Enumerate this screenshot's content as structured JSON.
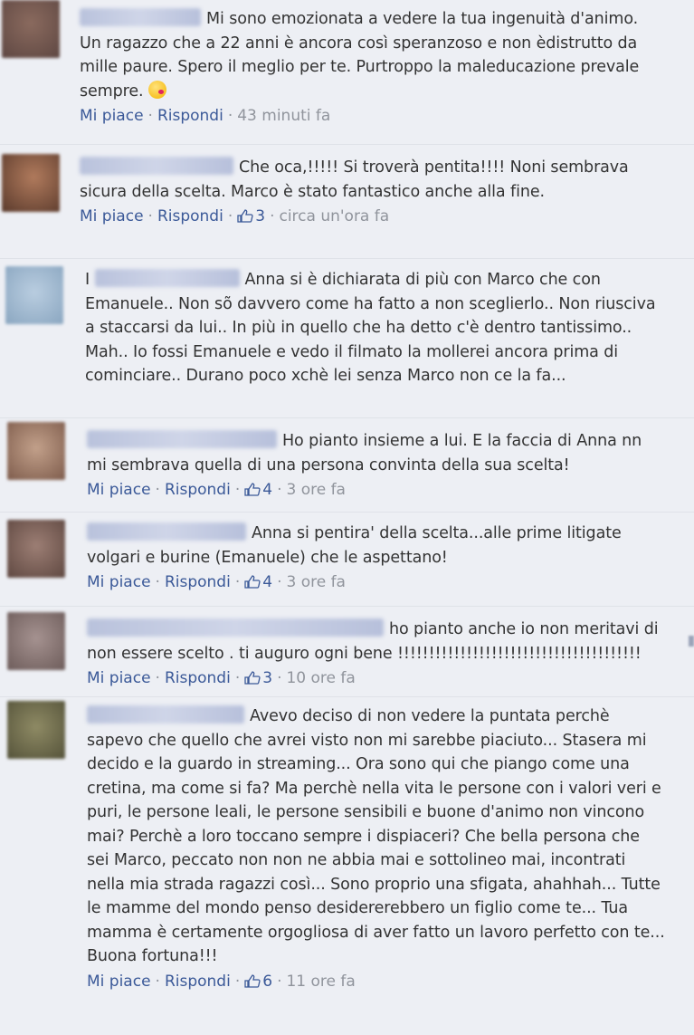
{
  "comments": [
    {
      "text": "Mi sono emozionata a vedere la tua ingenuità d'animo. Un ragazzo che a 22 anni è ancora così speranzoso e non èdistrutto da mille paure. Spero il meglio per te. Purtroppo la maleducazione prevale sempre.",
      "like_label": "Mi piace",
      "reply_label": "Rispondi",
      "likes": "",
      "time": "43 minuti fa"
    },
    {
      "text": "Che oca,!!!!! Si troverà pentita!!!! Noni sembrava sicura della scelta. Marco è stato fantastico anche alla fine.",
      "like_label": "Mi piace",
      "reply_label": "Rispondi",
      "likes": "3",
      "time": "circa un'ora fa"
    },
    {
      "text": "Anna si è dichiarata di più con Marco che con Emanuele.. Non sõ davvero come ha fatto a non sceglierlo.. Non riusciva a staccarsi da lui.. In più in quello che ha detto c'è dentro tantissimo.. Mah.. Io fossi Emanuele e vedo il filmato la mollerei ancora prima di cominciare.. Durano poco xchè lei senza Marco non ce la fa...",
      "prefix": "I",
      "like_label": "",
      "reply_label": "",
      "likes": "",
      "time": ""
    },
    {
      "text": "Ho pianto insieme a lui. E la faccia di Anna nn mi sembrava quella di una persona convinta della sua scelta!",
      "like_label": "Mi piace",
      "reply_label": "Rispondi",
      "likes": "4",
      "time": "3 ore fa"
    },
    {
      "text": "Anna si pentira' della scelta...alle prime litigate volgari e burine (Emanuele) che le aspettano!",
      "like_label": "Mi piace",
      "reply_label": "Rispondi",
      "likes": "4",
      "time": "3 ore fa"
    },
    {
      "text": "ho pianto anche io non meritavi di non essere scelto . ti auguro ogni bene !!!!!!!!!!!!!!!!!!!!!!!!!!!!!!!!!!!!!!!",
      "like_label": "Mi piace",
      "reply_label": "Rispondi",
      "likes": "3",
      "time": "10 ore fa"
    },
    {
      "text": "Avevo deciso di non vedere la puntata perchè sapevo che quello che avrei visto non mi sarebbe piaciuto... Stasera mi decido e la guardo in streaming... Ora sono qui che piango come una cretina, ma come si fa? Ma perchè nella vita le persone con i valori veri e puri, le persone leali, le persone sensibili e buone d'animo non vincono mai? Perchè a loro toccano sempre i dispiaceri? Che bella persona che sei Marco, peccato non non ne abbia mai e sottolineo mai, incontrati nella mia strada ragazzi così... Sono proprio una sfigata, ahahhah... Tutte le mamme del mondo penso desidererebbero un figlio come te... Tua mamma è certamente orgogliosa di aver fatto un lavoro perfetto con te... Buona fortuna!!!",
      "like_label": "Mi piace",
      "reply_label": "Rispondi",
      "likes": "6",
      "time": "11 ore fa"
    }
  ],
  "colors": {
    "link": "#3b5998",
    "muted": "#90949c",
    "background": "#edeff4",
    "text": "#333333"
  },
  "icons": {
    "like": "thumbs-up-icon",
    "emoji": "kiss-emoji-icon"
  }
}
